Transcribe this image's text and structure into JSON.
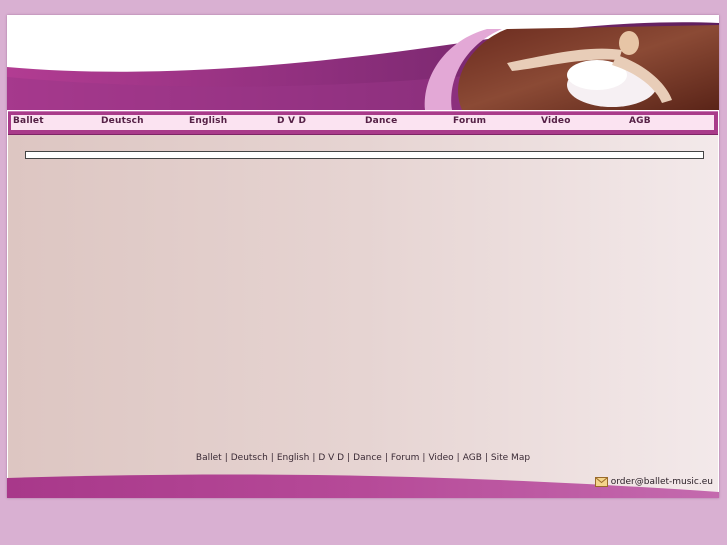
{
  "nav": {
    "items": [
      {
        "label": "Ballet"
      },
      {
        "label": "Deutsch"
      },
      {
        "label": "English"
      },
      {
        "label": "D V D"
      },
      {
        "label": "Dance"
      },
      {
        "label": "Forum"
      },
      {
        "label": "Video"
      },
      {
        "label": "AGB"
      }
    ]
  },
  "footer": {
    "links": [
      {
        "label": "Ballet"
      },
      {
        "label": "Deutsch"
      },
      {
        "label": "English"
      },
      {
        "label": "D V D"
      },
      {
        "label": "Dance"
      },
      {
        "label": "Forum"
      },
      {
        "label": "Video"
      },
      {
        "label": "AGB"
      },
      {
        "label": "Site Map"
      }
    ],
    "separator": "|",
    "email": "order@ballet-music.eu"
  },
  "colors": {
    "page_bg": "#d9b0d2",
    "brand_purple": "#a93b8a",
    "nav_bg": "#fbe3f1",
    "nav_text": "#552146"
  },
  "icons": {
    "email": "envelope-icon",
    "header_photo": "ballerina-photo"
  }
}
